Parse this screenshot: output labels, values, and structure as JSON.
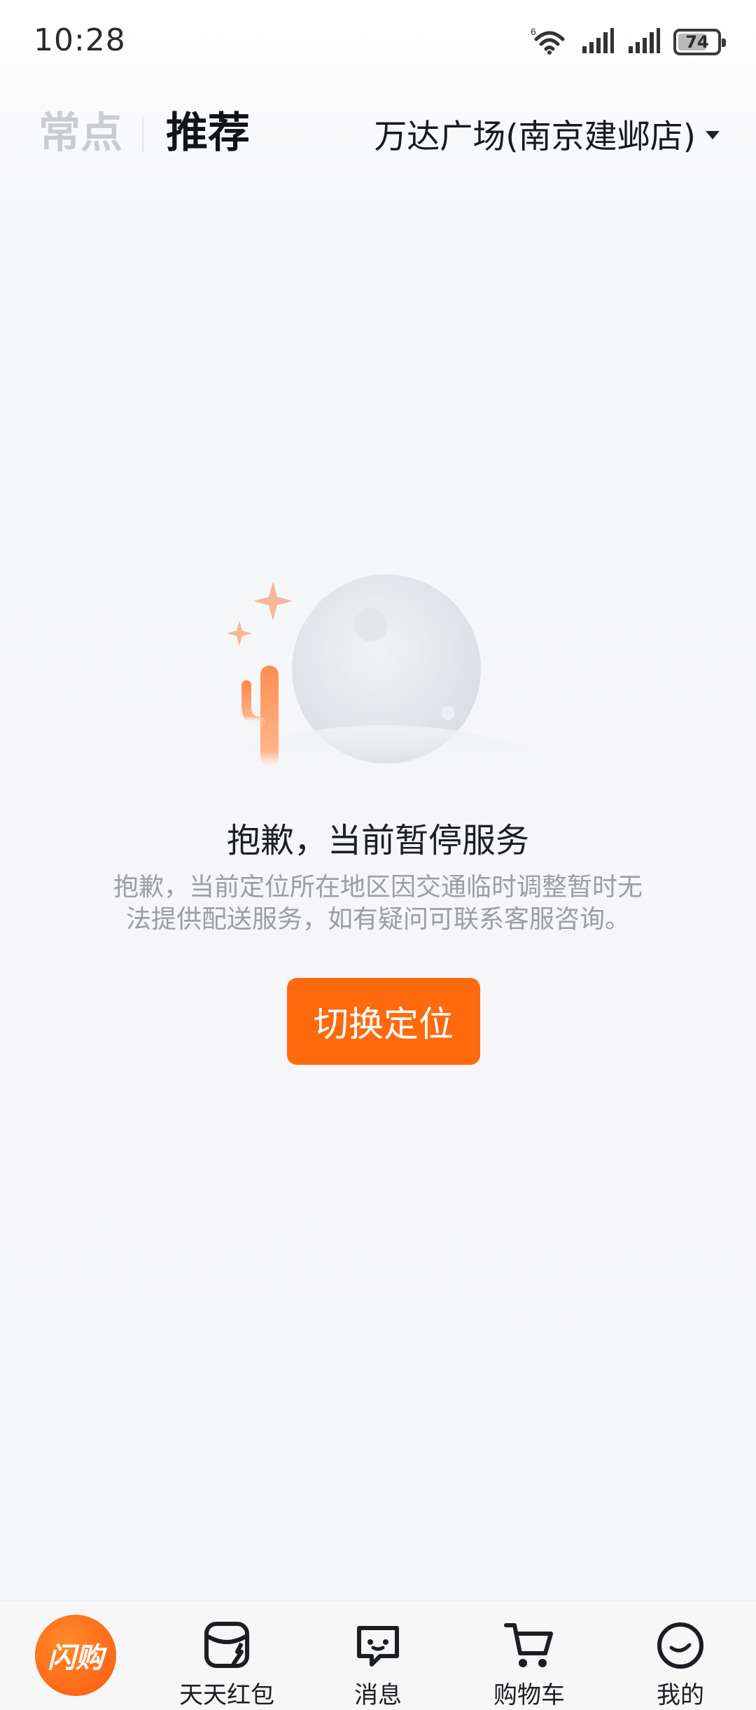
{
  "status_bar": {
    "time": "10:28",
    "battery_percent": 74,
    "battery_text": "74",
    "icons": [
      "wifi-6-icon",
      "signal-icon",
      "signal-icon",
      "battery-icon"
    ]
  },
  "header": {
    "tabs": [
      {
        "label": "常点",
        "active": false
      },
      {
        "label": "推荐",
        "active": true
      }
    ],
    "location": "万达广场(南京建邺店)"
  },
  "empty_state": {
    "title": "抱歉，当前暂停服务",
    "description_line1": "抱歉，当前定位所在地区因交通临时调整暂时无",
    "description_line2": "法提供配送服务，如有疑问可联系客服咨询。",
    "button_label": "切换定位"
  },
  "bottom_nav": {
    "home_logo_text": "闪购",
    "items": [
      {
        "label": "天天红包",
        "icon": "red-packet-icon"
      },
      {
        "label": "消息",
        "icon": "message-icon"
      },
      {
        "label": "购物车",
        "icon": "cart-icon"
      },
      {
        "label": "我的",
        "icon": "profile-icon"
      }
    ]
  },
  "colors": {
    "accent": "#ff6a0f",
    "inactive_tab": "#c9ccd1",
    "active_tab": "#111418",
    "desc_text": "#9a9ea5"
  }
}
